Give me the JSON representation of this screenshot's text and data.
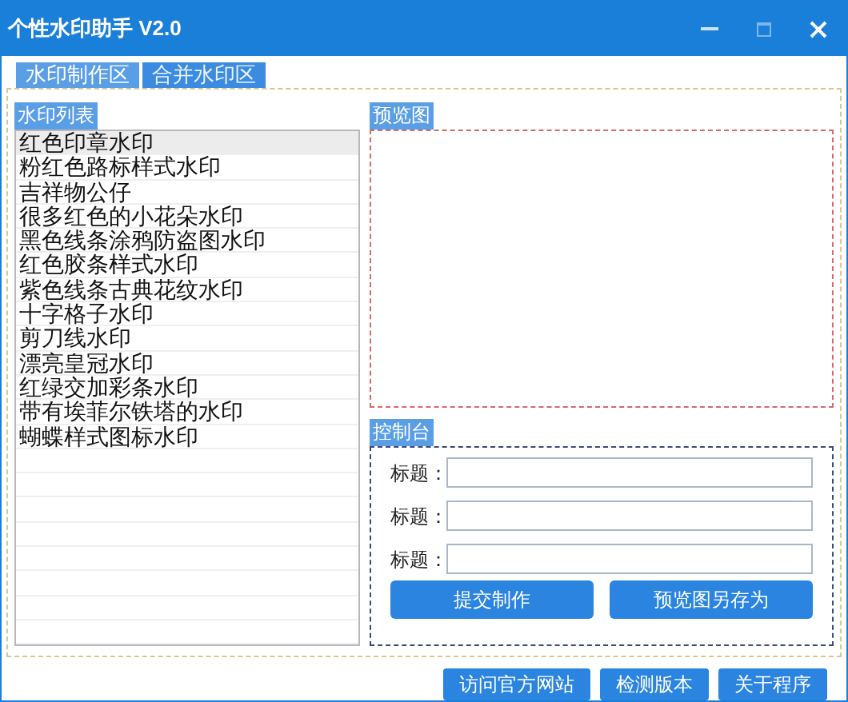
{
  "window": {
    "title": "个性水印助手 V2.0"
  },
  "tabs": [
    {
      "label": "水印制作区",
      "selected": true
    },
    {
      "label": "合并水印区",
      "selected": false
    }
  ],
  "watermark_list": {
    "title": "水印列表",
    "items": [
      {
        "label": "红色印章水印",
        "selected": true
      },
      {
        "label": "粉红色路标样式水印",
        "selected": false
      },
      {
        "label": "吉祥物公仔",
        "selected": false
      },
      {
        "label": "很多红色的小花朵水印",
        "selected": false
      },
      {
        "label": "黑色线条涂鸦防盗图水印",
        "selected": false
      },
      {
        "label": "红色胶条样式水印",
        "selected": false
      },
      {
        "label": "紫色线条古典花纹水印",
        "selected": false
      },
      {
        "label": "十字格子水印",
        "selected": false
      },
      {
        "label": "剪刀线水印",
        "selected": false
      },
      {
        "label": "漂亮皇冠水印",
        "selected": false
      },
      {
        "label": "红绿交加彩条水印",
        "selected": false
      },
      {
        "label": "带有埃菲尔铁塔的水印",
        "selected": false
      },
      {
        "label": "蝴蝶样式图标水印",
        "selected": false
      }
    ]
  },
  "preview": {
    "title": "预览图"
  },
  "console": {
    "title": "控制台",
    "fields": [
      {
        "label": "标题："
      },
      {
        "label": "标题："
      },
      {
        "label": "标题："
      }
    ],
    "buttons": [
      "提交制作",
      "预览图另存为"
    ]
  },
  "footer_buttons": [
    "访问官方网站",
    "检测版本",
    "关于程序"
  ]
}
